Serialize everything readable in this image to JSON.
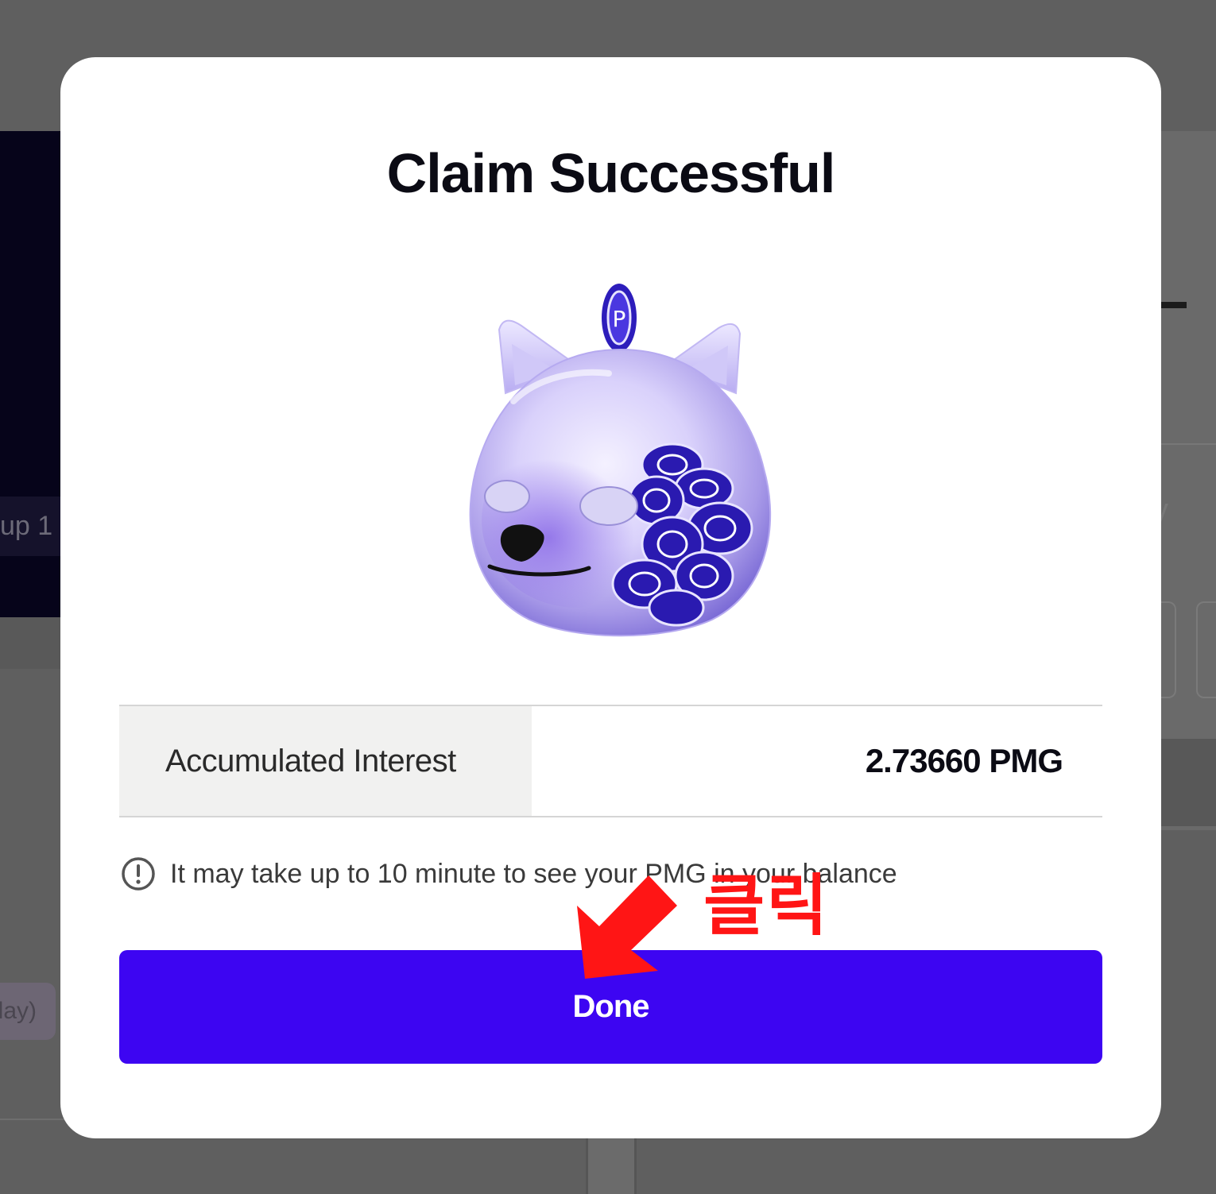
{
  "background": {
    "left_chip_text": "up 1",
    "left_pill_text": "day)",
    "right_glyph_text": "y"
  },
  "modal": {
    "title": "Claim Successful",
    "illustration_icon": "shiba-piggy-bank-icon",
    "info_row": {
      "label": "Accumulated Interest",
      "value": "2.73660 PMG"
    },
    "notice": {
      "icon": "exclamation-circle-icon",
      "text": "It may take up to 10 minute to see your PMG in your balance"
    },
    "done_button_label": "Done"
  },
  "annotation": {
    "text": "클릭",
    "icon": "red-arrow-icon",
    "color": "#ff1515"
  },
  "colors": {
    "primary_button": "#3d05f2",
    "overlay": "#5f5f5f",
    "modal_bg": "#ffffff"
  }
}
